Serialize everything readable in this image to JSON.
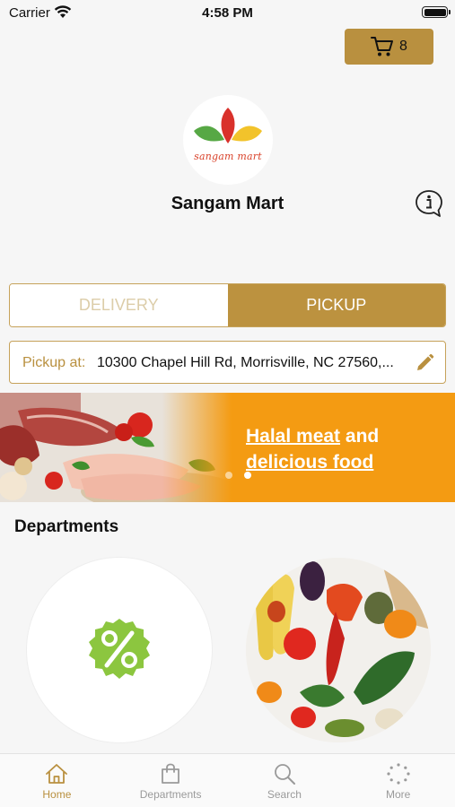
{
  "status_bar": {
    "carrier": "Carrier",
    "time": "4:58 PM"
  },
  "cart": {
    "count": "8"
  },
  "store": {
    "logo_text": "sangam mart",
    "name": "Sangam Mart"
  },
  "mode_toggle": {
    "options": [
      "DELIVERY",
      "PICKUP"
    ],
    "selected": "PICKUP"
  },
  "pickup": {
    "label": "Pickup at:",
    "address": "10300 Chapel Hill Rd, Morrisville, NC 27560,..."
  },
  "banner": {
    "line1_link": "Halal meat",
    "line1_rest": " and",
    "line2_link": "delicious food",
    "dots": 2,
    "active_dot": 1
  },
  "departments": {
    "heading": "Departments",
    "items": [
      {
        "icon": "discount-badge-icon"
      },
      {
        "icon": "vegetables-photo"
      }
    ]
  },
  "tab_bar": {
    "items": [
      {
        "label": "Home",
        "icon": "home-icon",
        "active": true
      },
      {
        "label": "Departments",
        "icon": "shopping-bag-icon",
        "active": false
      },
      {
        "label": "Search",
        "icon": "search-icon",
        "active": false
      },
      {
        "label": "More",
        "icon": "more-dots-icon",
        "active": false
      }
    ]
  },
  "colors": {
    "accent": "#b9903f",
    "banner": "#f49b12",
    "background": "#f6f6f6"
  }
}
